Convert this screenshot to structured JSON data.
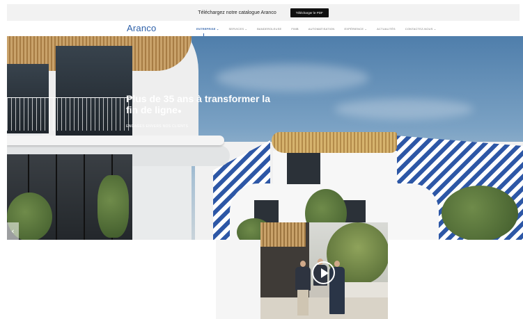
{
  "topbar": {
    "text": "Téléchargez notre catalogue Aranco",
    "button_label": "Télécharger le PDF"
  },
  "nav": {
    "logo": "Aranco",
    "items": [
      {
        "label": "ENTREPRISE ⌄",
        "active": true
      },
      {
        "label": "SERVICES ⌄",
        "active": false
      },
      {
        "label": "BANDEROLEUSE",
        "active": false
      },
      {
        "label": "FIMB",
        "active": false
      },
      {
        "label": "AUTOMATISATION",
        "active": false
      },
      {
        "label": "EXPÉRIENCE ⌄",
        "active": false
      },
      {
        "label": "ACTUALITÉS",
        "active": false
      },
      {
        "label": "CONTACTEZ-NOUS ⌄",
        "active": false
      }
    ]
  },
  "hero": {
    "title": "Plus de 35 ans à transformer la fin de ligne",
    "title_dot": "●",
    "subtitle": "ENGAGÉS ENVERS NOS CLIENTS",
    "prev_glyph": "‹"
  },
  "colors": {
    "brand": "#2c5fa8",
    "stripe_blue": "#2d57a6",
    "wood": "#c9a26a"
  },
  "icons": {
    "prev": "chevron-left-icon",
    "play": "play-icon"
  }
}
